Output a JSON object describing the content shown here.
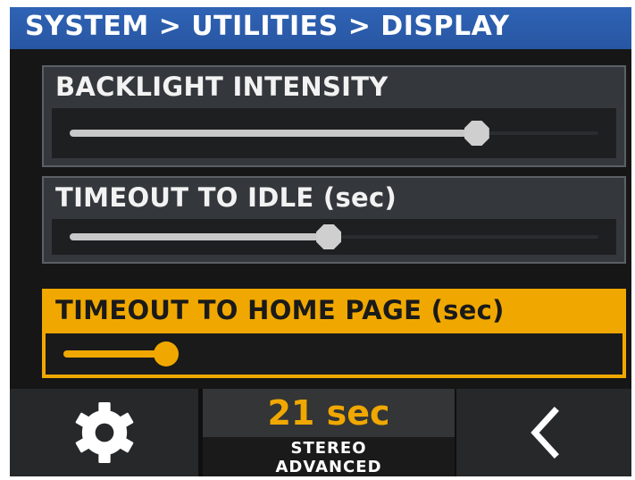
{
  "breadcrumb": "SYSTEM > UTILITIES > DISPLAY",
  "settings": [
    {
      "label": "BACKLIGHT INTENSITY",
      "level": 0.77,
      "active": false
    },
    {
      "label": "TIMEOUT TO IDLE (sec)",
      "level": 0.49,
      "active": false
    },
    {
      "label": "TIMEOUT TO HOME PAGE (sec)",
      "level": 0.19,
      "active": true
    }
  ],
  "bottom_bar": {
    "settings_icon": "gear-icon",
    "status_value": "21 sec",
    "status_line1": "STEREO",
    "status_line2": "ADVANCED",
    "back_icon": "chevron-left-icon"
  },
  "colors": {
    "header": "#2f63b5",
    "accent": "#f0a800",
    "panel": "#34383c",
    "background": "#161616"
  }
}
